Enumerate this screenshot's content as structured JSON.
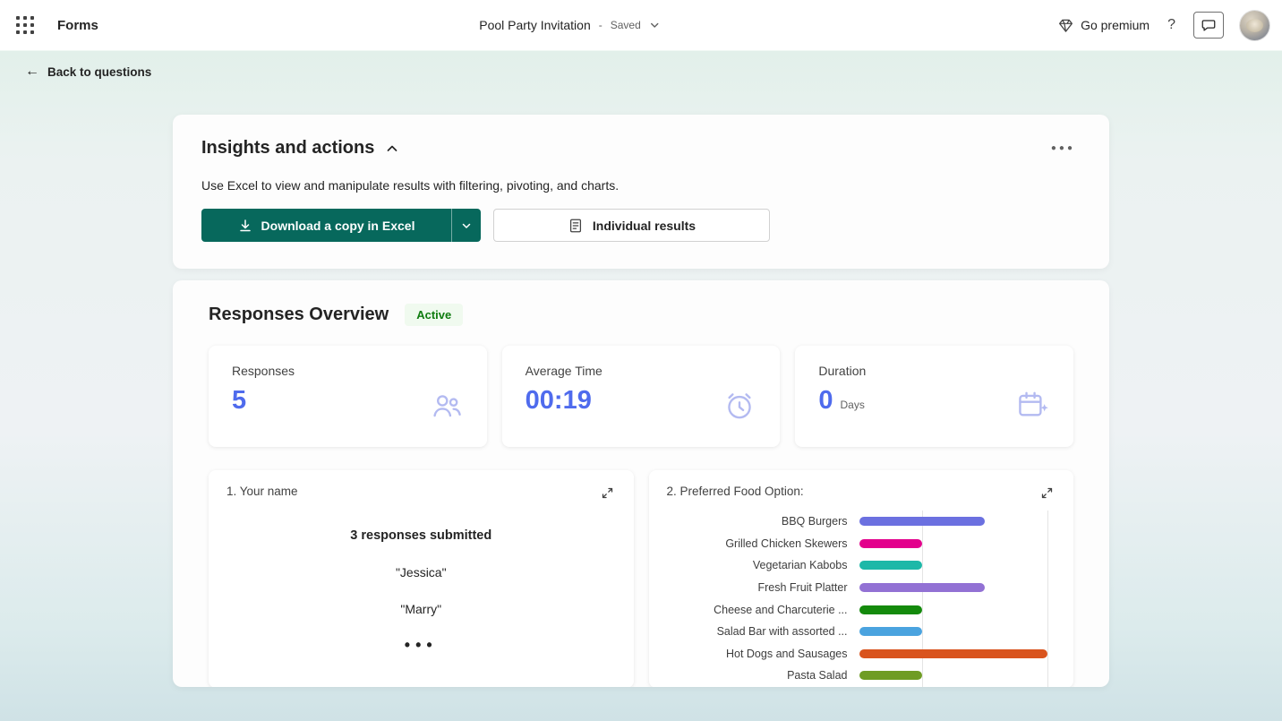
{
  "header": {
    "app_name": "Forms",
    "doc_title": "Pool Party Invitation",
    "separator": "-",
    "save_status": "Saved",
    "go_premium_label": "Go premium",
    "help_label": "?"
  },
  "nav": {
    "back_arrow": "←",
    "back_label": "Back to questions"
  },
  "insights": {
    "title": "Insights and actions",
    "more_icon": "●●●",
    "description": "Use Excel to view and manipulate results with filtering, pivoting, and charts.",
    "download_label": "Download a copy in Excel",
    "individual_results_label": "Individual results"
  },
  "overview": {
    "title": "Responses Overview",
    "status": "Active",
    "stats": [
      {
        "label": "Responses",
        "value": "5",
        "unit": ""
      },
      {
        "label": "Average Time",
        "value": "00:19",
        "unit": ""
      },
      {
        "label": "Duration",
        "value": "0",
        "unit": "Days"
      }
    ]
  },
  "question_name": {
    "title": "1. Your name",
    "summary": "3 responses submitted",
    "responses": [
      "\"Jessica\"",
      "\"Marry\""
    ],
    "ellipsis": "•••"
  },
  "question_food": {
    "title": "2. Preferred Food Option:"
  },
  "chart_data": {
    "type": "bar",
    "orientation": "horizontal",
    "title": "2. Preferred Food Option:",
    "categories": [
      "BBQ Burgers",
      "Grilled Chicken Skewers",
      "Vegetarian Kabobs",
      "Fresh Fruit Platter",
      "Cheese and Charcuterie ...",
      "Salad Bar with assorted ...",
      "Hot Dogs and Sausages",
      "Pasta Salad"
    ],
    "values": [
      2,
      1,
      1,
      2,
      1,
      1,
      3,
      1
    ],
    "colors": [
      "#6b70e0",
      "#e3008c",
      "#1db8a8",
      "#9271d4",
      "#148a0c",
      "#4aa3df",
      "#d9541e",
      "#6f9c24"
    ],
    "xlim": [
      0,
      3
    ],
    "gridlines": [
      1,
      3
    ],
    "legend": "none",
    "xlabel": "",
    "ylabel": ""
  },
  "colors": {
    "primary_teal": "#07685c",
    "stat_blue": "#4f6bed",
    "active_green": "#107c10"
  }
}
